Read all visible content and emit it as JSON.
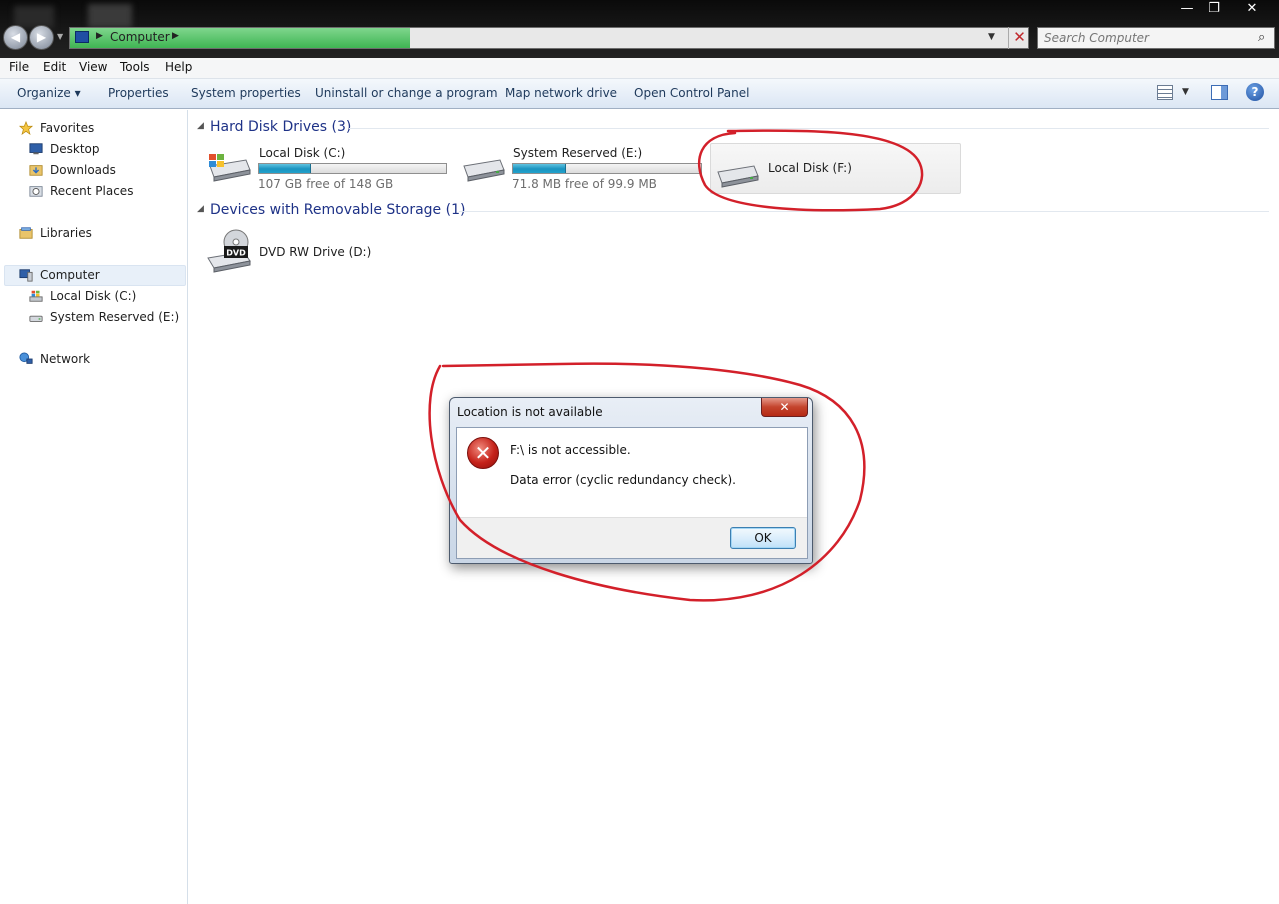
{
  "address_bar": {
    "location": "Computer",
    "search_placeholder": "Search Computer"
  },
  "window_controls": {
    "minimize": "—",
    "maximize": "❐",
    "close": "✕"
  },
  "menu": [
    "File",
    "Edit",
    "View",
    "Tools",
    "Help"
  ],
  "command_bar": {
    "organize": "Organize ▾",
    "items": [
      "Properties",
      "System properties",
      "Uninstall or change a program",
      "Map network drive",
      "Open Control Panel"
    ],
    "help": "?"
  },
  "nav_pane": {
    "favorites": {
      "label": "Favorites",
      "items": [
        "Desktop",
        "Downloads",
        "Recent Places"
      ]
    },
    "libraries": "Libraries",
    "computer": {
      "label": "Computer",
      "items": [
        "Local Disk (C:)",
        "System Reserved (E:)"
      ]
    },
    "network": "Network"
  },
  "groups": {
    "hard_disks": {
      "header": "Hard Disk Drives (3)",
      "drives": [
        {
          "name": "Local Disk (C:)",
          "free_text": "107 GB free of 148 GB",
          "used_fraction": 0.277
        },
        {
          "name": "System Reserved (E:)",
          "free_text": "71.8 MB free of 99.9 MB",
          "used_fraction": 0.281
        },
        {
          "name": "Local Disk (F:)"
        }
      ]
    },
    "removable": {
      "header": "Devices with Removable Storage (1)",
      "drives": [
        {
          "name": "DVD RW Drive (D:)",
          "icon_label": "DVD"
        }
      ]
    }
  },
  "dialog": {
    "title": "Location is not available",
    "close": "✕",
    "icon": "✕",
    "message": "F:\\ is not accessible.",
    "detail": "Data error (cyclic redundancy check).",
    "ok": "OK"
  },
  "colors": {
    "annotation": "#d3202a",
    "group_header": "#1e3287",
    "progress_green": "#3fb553",
    "drive_fill": "#1a93bf"
  },
  "icons": {
    "back": "◀",
    "forward": "▶",
    "breadcrumb_arrow": "▶",
    "dropdown": "▼",
    "stop": "✕",
    "search": "⌕"
  }
}
